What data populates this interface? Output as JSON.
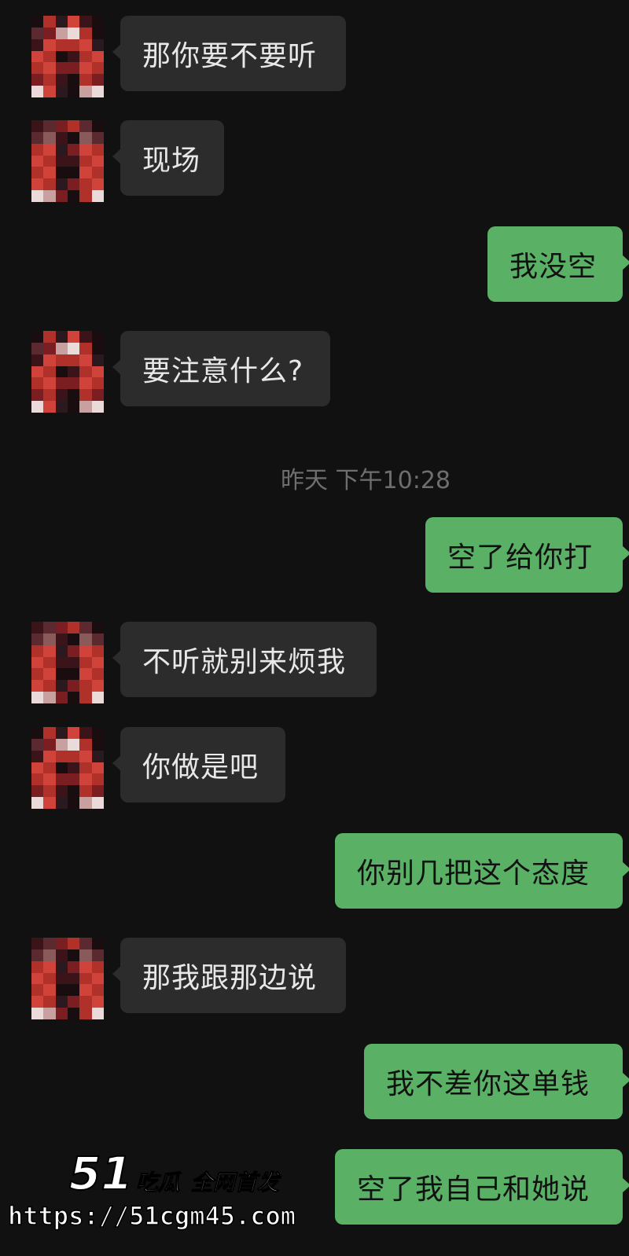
{
  "messages": [
    {
      "side": "in",
      "text": "那你要不要听"
    },
    {
      "side": "in",
      "text": "现场"
    },
    {
      "side": "out",
      "text": "我没空"
    },
    {
      "side": "in",
      "text": "要注意什么?"
    },
    {
      "side": "out",
      "text": "空了给你打"
    },
    {
      "side": "in",
      "text": "不听就别来烦我"
    },
    {
      "side": "in",
      "text": "你做是吧"
    },
    {
      "side": "out",
      "text": "你别几把这个态度"
    },
    {
      "side": "in",
      "text": "那我跟那边说"
    },
    {
      "side": "out",
      "text": "我不差你这单钱"
    },
    {
      "side": "out",
      "text": "空了我自己和她说"
    }
  ],
  "timestamp": "昨天 下午10:28",
  "watermark": {
    "number": "51",
    "brand": "吃瓜",
    "tag": "全网首发",
    "url": "https://51cgm45.com"
  },
  "colors": {
    "background": "#111111",
    "incoming_bubble": "#2c2c2c",
    "outgoing_bubble": "#5ab166",
    "timestamp_text": "#6e6e6e"
  }
}
